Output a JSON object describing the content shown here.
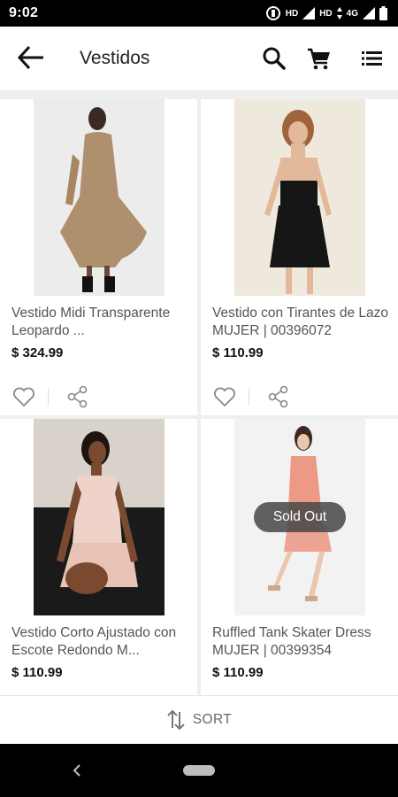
{
  "status": {
    "time": "9:02",
    "network_1": "HD",
    "network_2": "HD",
    "network_3": "4G"
  },
  "header": {
    "title": "Vestidos"
  },
  "products": [
    {
      "name": "Vestido Midi Transparente Leopardo ...",
      "price": "$ 324.99"
    },
    {
      "name": "Vestido con Tirantes de Lazo MUJER | 00396072",
      "price": "$ 110.99"
    },
    {
      "name": "Vestido Corto Ajustado con Escote Redondo M...",
      "price": "$ 110.99"
    },
    {
      "name": "Ruffled Tank Skater Dress MUJER | 00399354",
      "price": "$ 110.99",
      "badge": "Sold Out"
    }
  ],
  "sort": {
    "label": "SORT"
  },
  "colors": {
    "background": "#ffffff",
    "grid_gap": "#efefef",
    "badge": "#464646"
  }
}
